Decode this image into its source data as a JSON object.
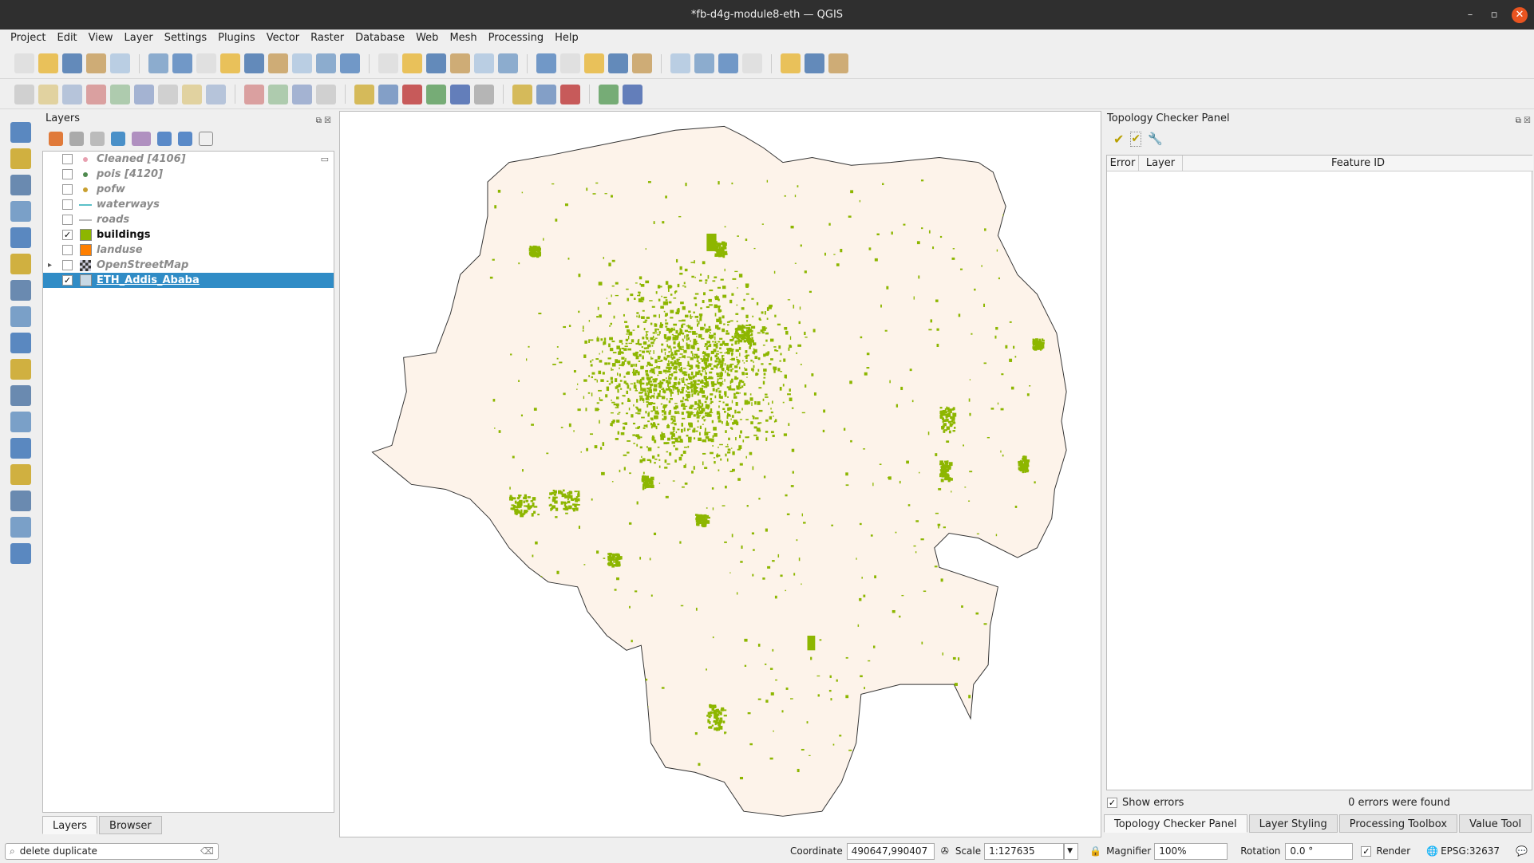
{
  "window": {
    "title": "*fb-d4g-module8-eth — QGIS"
  },
  "menu": [
    "Project",
    "Edit",
    "View",
    "Layer",
    "Settings",
    "Plugins",
    "Vector",
    "Raster",
    "Database",
    "Web",
    "Mesh",
    "Processing",
    "Help"
  ],
  "layers_panel": {
    "title": "Layers",
    "items": [
      {
        "name": "Cleaned [4106]",
        "checked": false,
        "symbol": "point",
        "color": "#e8a0b0"
      },
      {
        "name": "pois [4120]",
        "checked": false,
        "symbol": "point",
        "color": "#4f8a4f"
      },
      {
        "name": "pofw",
        "checked": false,
        "symbol": "point",
        "color": "#c8a030"
      },
      {
        "name": "waterways",
        "checked": false,
        "symbol": "line",
        "color": "#5bc0c8"
      },
      {
        "name": "roads",
        "checked": false,
        "symbol": "line",
        "color": "#bbbbbb"
      },
      {
        "name": "buildings",
        "checked": true,
        "symbol": "fill",
        "color": "#8db600"
      },
      {
        "name": "landuse",
        "checked": false,
        "symbol": "fill",
        "color": "#ff7f00"
      },
      {
        "name": "OpenStreetMap",
        "checked": false,
        "symbol": "raster",
        "color": "#333333"
      },
      {
        "name": "ETH_Addis_Ababa",
        "checked": true,
        "symbol": "fill",
        "color": "#c8d8e4",
        "selected": true
      }
    ],
    "tabs": [
      "Layers",
      "Browser"
    ]
  },
  "map": {
    "boundary_fill": "#fdf3ea",
    "buildings_color": "#8db600"
  },
  "topology": {
    "title": "Topology Checker Panel",
    "columns": [
      "Error",
      "Layer",
      "Feature ID"
    ],
    "show_errors_label": "Show errors",
    "show_errors": true,
    "status": "0 errors were found",
    "tabs": [
      "Topology Checker Panel",
      "Layer Styling",
      "Processing Toolbox",
      "Value Tool"
    ]
  },
  "statusbar": {
    "search_value": "delete duplicate",
    "coordinate_label": "Coordinate",
    "coordinate": "490647,990407",
    "scale_label": "Scale",
    "scale": "1:127635",
    "magnifier_label": "Magnifier",
    "magnifier": "100%",
    "rotation_label": "Rotation",
    "rotation": "0.0 °",
    "render_label": "Render",
    "render": true,
    "crs": "EPSG:32637"
  }
}
